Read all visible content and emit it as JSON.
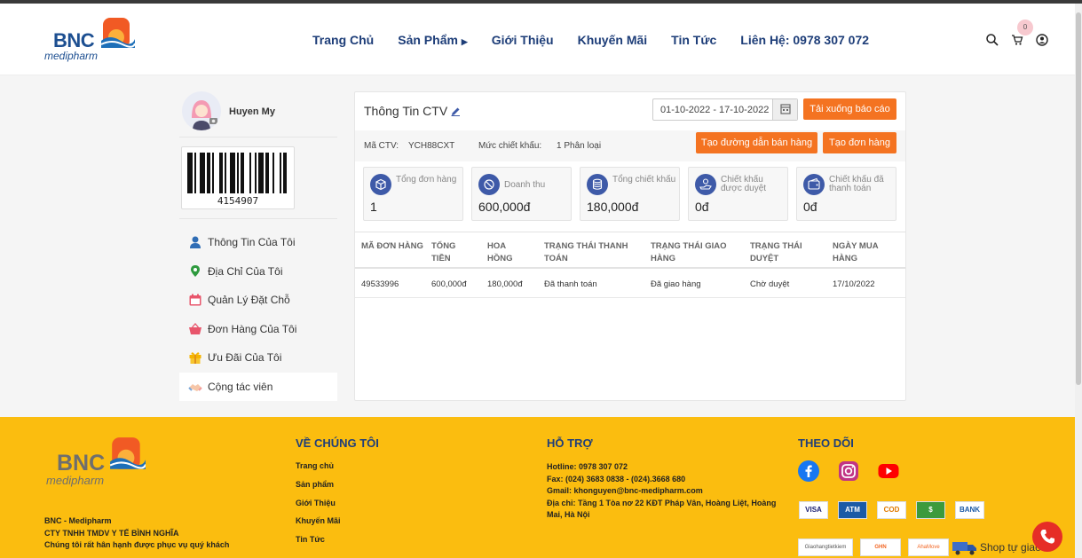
{
  "header": {
    "logo_text": "BNC",
    "logo_sub": "medipharm",
    "nav": [
      "Trang Chủ",
      "Sản Phẩm",
      "Giới Thiệu",
      "Khuyến Mãi",
      "Tin Tức",
      "Liên Hệ: 0978 307 072"
    ],
    "cart_count": "0",
    "icons": [
      "search-icon",
      "cart-icon",
      "user-icon"
    ]
  },
  "sidebar": {
    "user_name": "Huyen My",
    "barcode_number": "4154907",
    "menu": [
      {
        "label": "Thông Tin Của Tôi",
        "icon": "user-icon"
      },
      {
        "label": "Địa Chỉ Của Tôi",
        "icon": "location-icon"
      },
      {
        "label": "Quản Lý Đặt Chỗ",
        "icon": "calendar-icon"
      },
      {
        "label": "Đơn Hàng Của Tôi",
        "icon": "basket-icon"
      },
      {
        "label": "Ưu Đãi Của Tôi",
        "icon": "gift-icon"
      },
      {
        "label": "Cộng tác viên",
        "icon": "handshake-icon"
      }
    ]
  },
  "main": {
    "title": "Thông Tin CTV",
    "date_range": "01-10-2022 - 17-10-2022",
    "download_label": "Tải xuống báo cáo",
    "ctv_label": "Mã CTV:",
    "ctv_code": "YCH88CXT",
    "discount_label": "Mức chiết khấu:",
    "discount_value": "1 Phân loại",
    "create_link_label": "Tạo đường dẫn bán hàng",
    "create_order_label": "Tạo đơn hàng",
    "stats": [
      {
        "label": "Tổng đơn hàng",
        "value": "1"
      },
      {
        "label": "Doanh thu",
        "value": "600,000đ"
      },
      {
        "label": "Tổng chiết khấu",
        "value": "180,000đ"
      },
      {
        "label": "Chiết khấu được duyệt",
        "value": "0đ"
      },
      {
        "label": "Chiết khấu đã thanh toán",
        "value": "0đ"
      }
    ],
    "table_headers": [
      "Mã đơn hàng",
      "Tổng tiền",
      "Hoa hồng",
      "Trạng thái thanh toán",
      "Trạng thái giao hàng",
      "Trạng thái duyệt",
      "Ngày mua hàng"
    ],
    "table_rows": [
      [
        "49533996",
        "600,000đ",
        "180,000đ",
        "Đã thanh toán",
        "Đã giao hàng",
        "Chờ duyệt",
        "17/10/2022"
      ]
    ]
  },
  "footer": {
    "logo_text": "BNC",
    "logo_sub": "medipharm",
    "company_lines": [
      "BNC - Medipharm",
      "CTY TNHH TMDV Y TẾ BÌNH NGHĨA",
      "Chúng tôi rất hân hạnh được phục vụ quý khách"
    ],
    "about_heading": "VỀ CHÚNG TÔI",
    "about_links": [
      "Trang chủ",
      "Sản phẩm",
      "Giới Thiệu",
      "Khuyến Mãi",
      "Tin Tức"
    ],
    "support_heading": "HỖ TRỢ",
    "support_lines": [
      "Hotline: 0978 307 072",
      "Fax: (024) 3683 0838 - (024).3668 680",
      "Gmail: khonguyen@bnc-medipharm.com",
      "Địa chỉ: Tầng 1 Tòa nơ 22 KĐT Pháp Vân, Hoàng Liệt, Hoàng Mai, Hà Nội"
    ],
    "follow_heading": "THEO DÕI",
    "social_icons": [
      "facebook-icon",
      "instagram-icon",
      "youtube-icon"
    ],
    "payment_labels": [
      "VISA",
      "ATM",
      "COD",
      "$",
      "BANK"
    ],
    "shipping_labels": [
      "Giaohangtietkiem",
      "GHN",
      "AhaMove"
    ],
    "ship_self_label": "Shop tự giao"
  },
  "colors": {
    "accent": "#f47321",
    "brand_blue": "#1d3d78",
    "footer_bg": "#fbbd0f",
    "stat_icon": "#3e5aa8"
  }
}
